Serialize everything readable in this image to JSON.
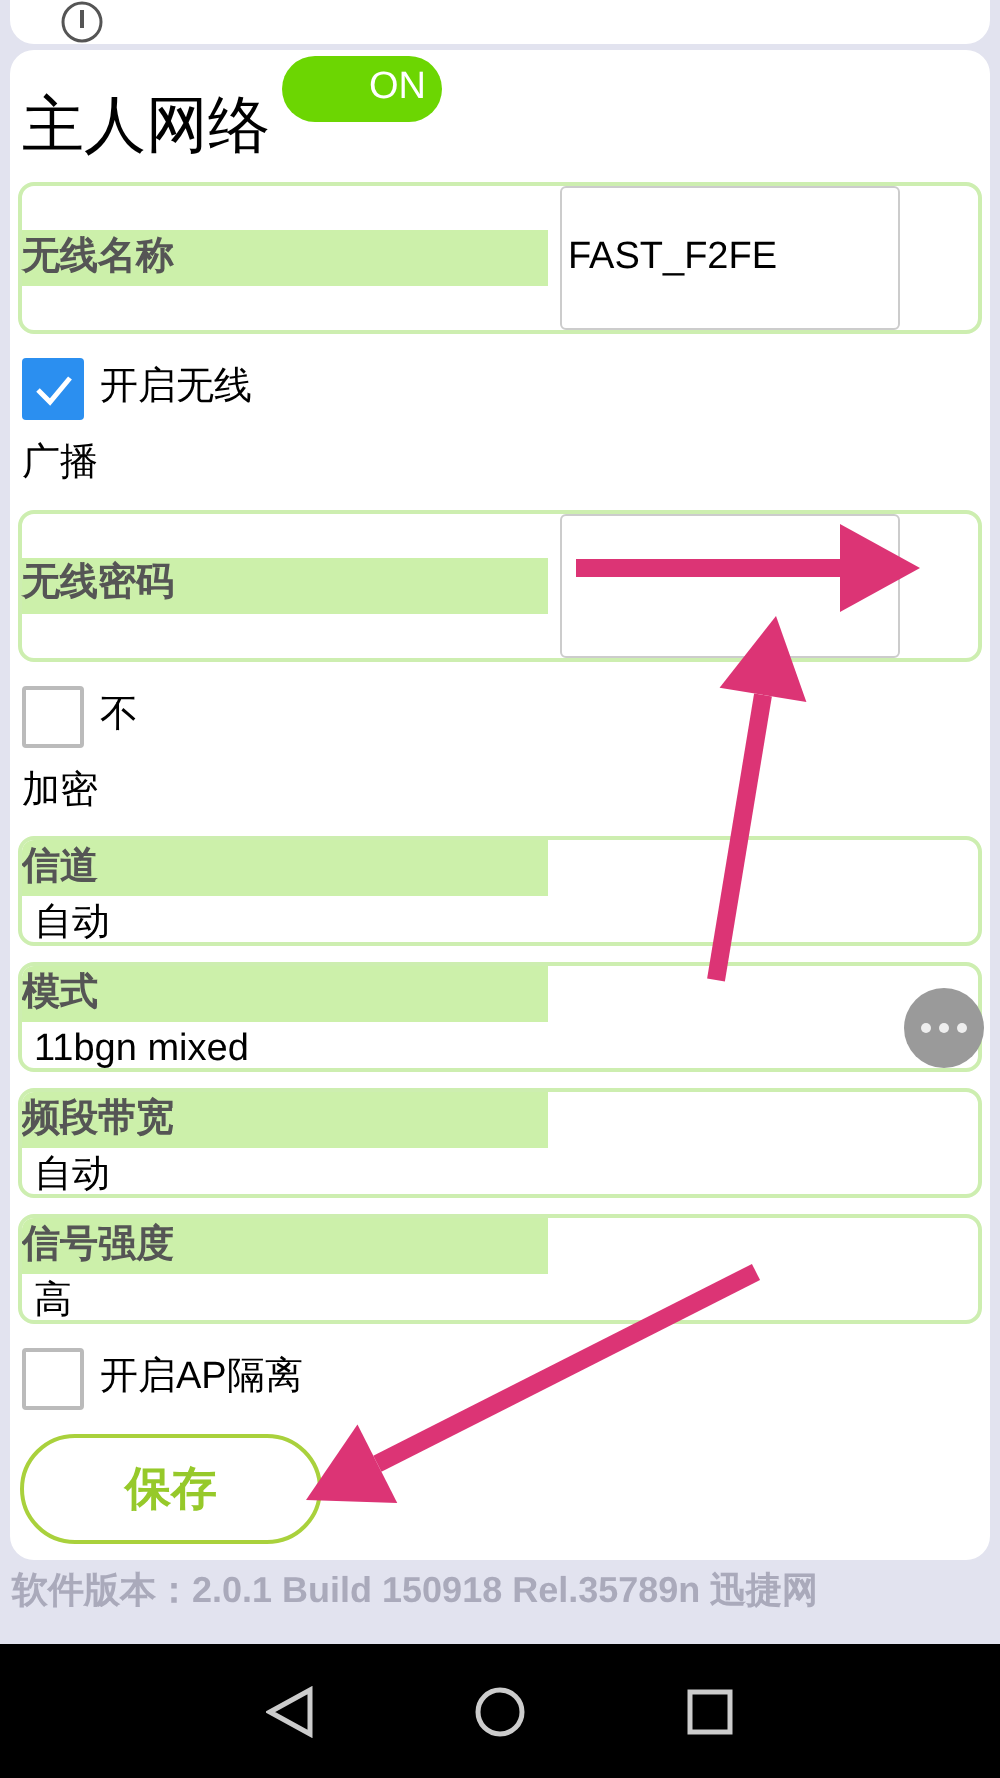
{
  "title": "主人网络",
  "switch": {
    "label": "ON",
    "on": true
  },
  "fields": [
    {
      "kind": "input",
      "label": "无线名称",
      "value": "FAST_F2FE"
    },
    {
      "kind": "checkbox",
      "label_lines": [
        "开启无线",
        "广播"
      ],
      "checked": true
    },
    {
      "kind": "input",
      "label": "无线密码"
    },
    {
      "kind": "checkbox",
      "label_lines": [
        "不",
        "加密"
      ],
      "checked": false
    },
    {
      "kind": "select",
      "label": "信道",
      "value": "自动"
    },
    {
      "kind": "select",
      "label": "模式",
      "value": "11bgn mixed"
    },
    {
      "kind": "select",
      "label": "频段带宽",
      "value": "自动"
    },
    {
      "kind": "select",
      "label": "信号强度",
      "value": "高"
    },
    {
      "kind": "checkbox",
      "label_lines": [
        "开启AP隔离"
      ],
      "checked": false
    }
  ],
  "save_button": "保存",
  "footer": "软件版本：2.0.1 Build 150918 Rel.35789n  迅捷网"
}
